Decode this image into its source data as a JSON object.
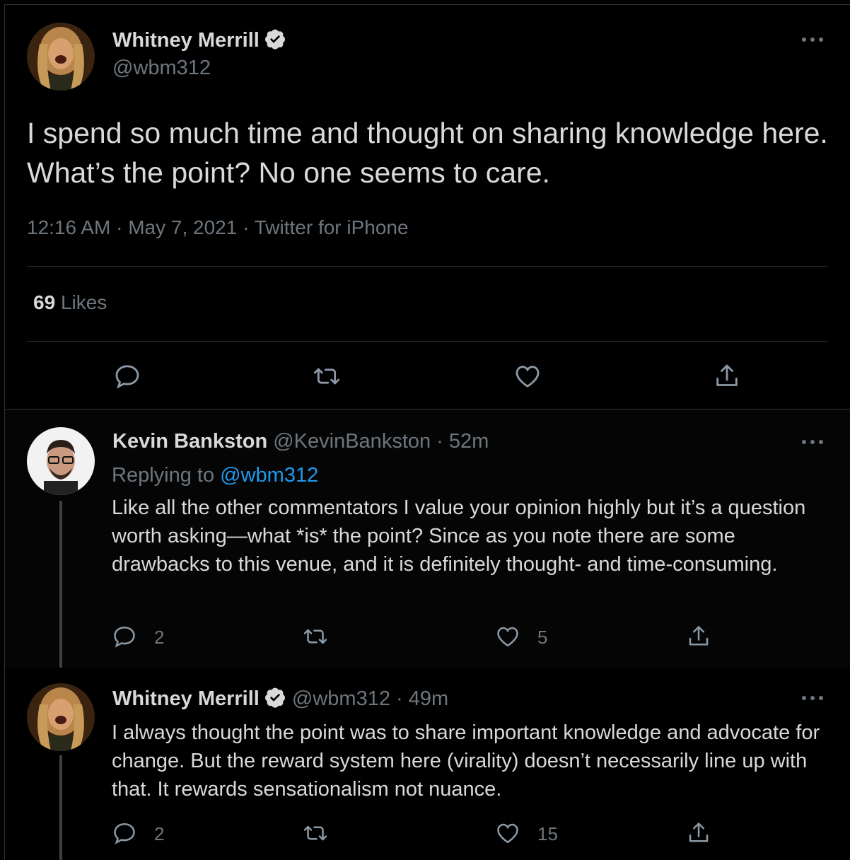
{
  "main_tweet": {
    "author_name": "Whitney Merrill",
    "handle": "@wbm312",
    "text": "I spend so much time and thought on sharing knowledge here. What’s the point? No one seems to care.",
    "time": "12:16 AM",
    "date": "May 7, 2021",
    "source": "Twitter for iPhone",
    "likes_count": "69",
    "likes_label": "Likes"
  },
  "replies": [
    {
      "author_name": "Kevin Bankston",
      "handle": "@KevinBankston",
      "age": "52m",
      "replying_prefix": "Replying to",
      "replying_to": "@wbm312",
      "text": "Like all the other commentators I value your opinion highly but it’s a question worth asking—what *is* the point? Since as you note there are some drawbacks to this venue, and it is definitely thought- and time-consuming.",
      "reply_count": "2",
      "retweet_count": "",
      "like_count": "5"
    },
    {
      "author_name": "Whitney Merrill",
      "handle": "@wbm312",
      "age": "49m",
      "text": "I always thought the point was to share important knowledge and advocate for change. But the reward system here (virality) doesn’t necessarily line up with that. It rewards sensationalism not nuance.",
      "reply_count": "2",
      "retweet_count": "",
      "like_count": "15"
    }
  ],
  "separator": " · ",
  "colors": {
    "background": "#000000",
    "text": "#d9d9d9",
    "muted": "#6e767d",
    "link": "#1d9bf0",
    "border": "#2f3336"
  },
  "icons": [
    "reply-icon",
    "retweet-icon",
    "like-icon",
    "share-icon",
    "verified-badge-icon",
    "more-icon"
  ]
}
